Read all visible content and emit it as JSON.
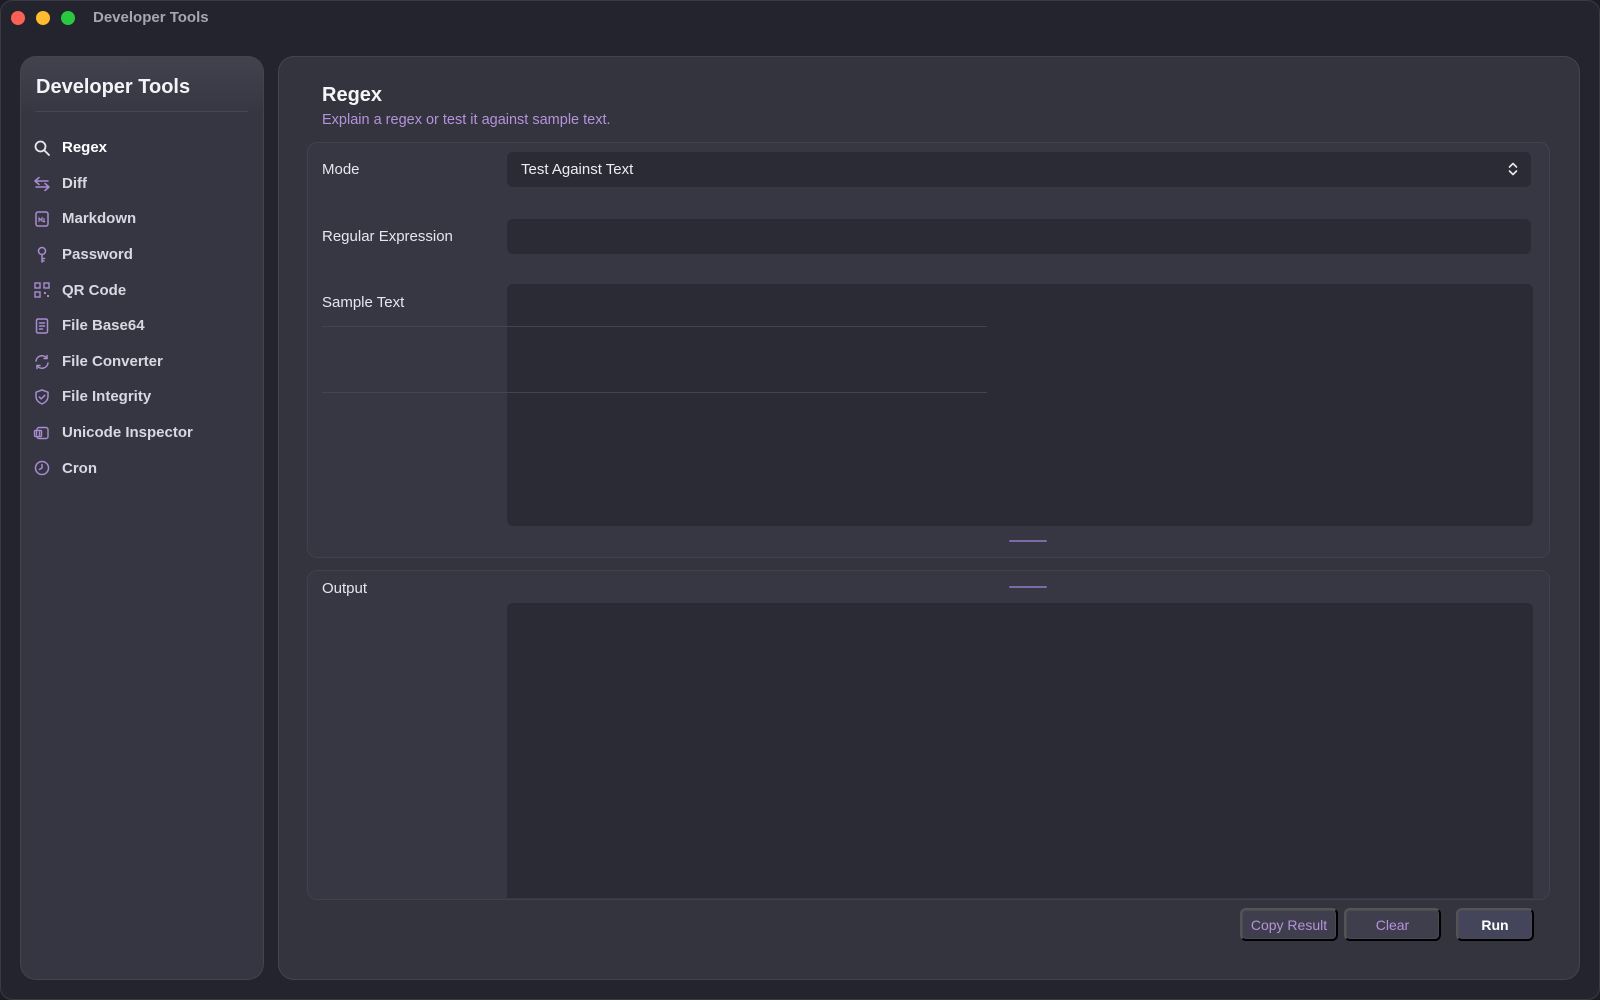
{
  "window": {
    "title": "Developer Tools"
  },
  "sidebar": {
    "title": "Developer Tools",
    "items": [
      {
        "label": "Regex",
        "icon": "search-icon",
        "active": true
      },
      {
        "label": "Diff",
        "icon": "arrows-swap-icon"
      },
      {
        "label": "Markdown",
        "icon": "markdown-doc-icon"
      },
      {
        "label": "Password",
        "icon": "key-icon"
      },
      {
        "label": "QR Code",
        "icon": "qr-code-icon"
      },
      {
        "label": "File Base64",
        "icon": "file-doc-icon"
      },
      {
        "label": "File Converter",
        "icon": "refresh-arrows-icon"
      },
      {
        "label": "File Integrity",
        "icon": "shield-check-icon"
      },
      {
        "label": "Unicode Inspector",
        "icon": "unicode-icon"
      },
      {
        "label": "Cron",
        "icon": "clock-icon"
      }
    ]
  },
  "main": {
    "title": "Regex",
    "subtitle": "Explain a regex or test it against sample text.",
    "mode": {
      "label": "Mode",
      "value": "Test Against Text"
    },
    "regex": {
      "label": "Regular Expression",
      "value": ""
    },
    "sample": {
      "label": "Sample Text",
      "value": ""
    },
    "output": {
      "label": "Output",
      "value": ""
    },
    "buttons": {
      "copy": "Copy Result",
      "clear": "Clear",
      "run": "Run"
    }
  },
  "colors": {
    "accent": "#b593dc",
    "background": "#24242e",
    "panel": "#34343f",
    "field": "#2b2b35"
  }
}
